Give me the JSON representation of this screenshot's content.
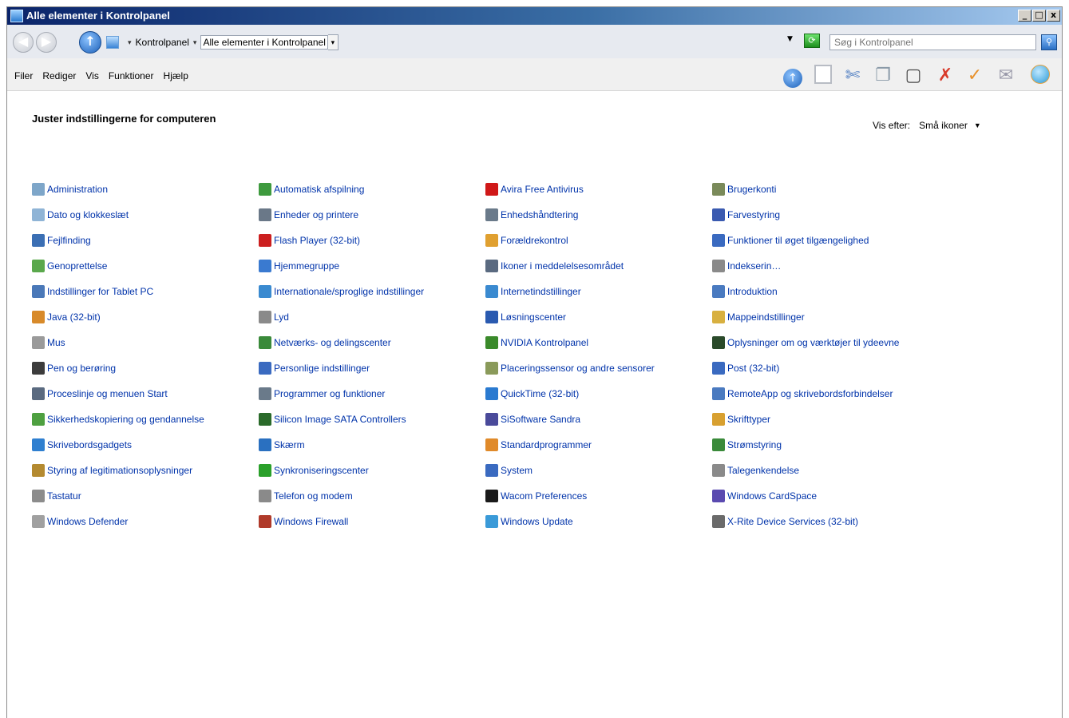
{
  "window": {
    "title": "Alle elementer i Kontrolpanel"
  },
  "caption_buttons": {
    "minimize": "_",
    "maximize": "□",
    "close": "x"
  },
  "address": {
    "crumbs": [
      "Kontrolpanel",
      "Alle elementer i Kontrolpanel"
    ],
    "separator": "▾"
  },
  "search": {
    "placeholder": "Søg i Kontrolpanel"
  },
  "menu": [
    "Filer",
    "Rediger",
    "Vis",
    "Funktioner",
    "Hjælp"
  ],
  "toolbar_icons": [
    "up-icon",
    "panel-icon",
    "cut-icon",
    "copy-icon",
    "paste-icon",
    "delete-icon",
    "check-icon",
    "mail-icon",
    "globe-icon"
  ],
  "content": {
    "title": "Juster indstillingerne for computeren",
    "view_by_label": "Vis efter:",
    "view_by_value": "Små ikoner"
  },
  "columns": [
    [
      {
        "label": "Administration",
        "icon": "gear-icon",
        "color": "#7ea6c9"
      },
      {
        "label": "Dato og klokkeslæt",
        "icon": "clock-icon",
        "color": "#8fb4d6"
      },
      {
        "label": "Fejlfinding",
        "icon": "monitor-icon",
        "color": "#3b6fb4"
      },
      {
        "label": "Genoprettelse",
        "icon": "restore-icon",
        "color": "#5aa84c"
      },
      {
        "label": "Indstillinger for Tablet PC",
        "icon": "tablet-icon",
        "color": "#4a78b8"
      },
      {
        "label": "Java (32-bit)",
        "icon": "java-icon",
        "color": "#d88a2a"
      },
      {
        "label": "Mus",
        "icon": "mouse-icon",
        "color": "#9a9a9a"
      },
      {
        "label": "Pen og berøring",
        "icon": "pen-icon",
        "color": "#3c3c3c"
      },
      {
        "label": "Proceslinje og menuen Start",
        "icon": "taskbar-icon",
        "color": "#5a6a80"
      },
      {
        "label": "Sikkerhedskopiering og gendannelse",
        "icon": "backup-icon",
        "color": "#4ea040"
      },
      {
        "label": "Skrivebordsgadgets",
        "icon": "gadgets-icon",
        "color": "#2f7fd0"
      },
      {
        "label": "Styring af legitimationsoplysninger",
        "icon": "credentials-icon",
        "color": "#b48a30"
      },
      {
        "label": "Tastatur",
        "icon": "keyboard-icon",
        "color": "#8c8c8c"
      },
      {
        "label": "Windows Defender",
        "icon": "defender-icon",
        "color": "#a0a0a0"
      }
    ],
    [
      {
        "label": "Automatisk afspilning",
        "icon": "autoplay-icon",
        "color": "#3e9a3e"
      },
      {
        "label": "Enheder og printere",
        "icon": "printer-icon",
        "color": "#6a7888"
      },
      {
        "label": "Flash Player (32-bit)",
        "icon": "flash-icon",
        "color": "#cc1f1f"
      },
      {
        "label": "Hjemmegruppe",
        "icon": "homegroup-icon",
        "color": "#3a7ad0"
      },
      {
        "label": "Internationale/sproglige indstillinger",
        "icon": "globe-clock-icon",
        "color": "#3a8ad0"
      },
      {
        "label": "Lyd",
        "icon": "speaker-icon",
        "color": "#8a8a8a"
      },
      {
        "label": "Netværks- og delingscenter",
        "icon": "network-icon",
        "color": "#3a8a3a"
      },
      {
        "label": "Personlige indstillinger",
        "icon": "personalize-icon",
        "color": "#3a6ac0"
      },
      {
        "label": "Programmer og funktioner",
        "icon": "programs-icon",
        "color": "#6a7a8a"
      },
      {
        "label": "Silicon Image SATA Controllers",
        "icon": "sata-icon",
        "color": "#2a6a2a"
      },
      {
        "label": "Skærm",
        "icon": "display-icon",
        "color": "#2a70c0"
      },
      {
        "label": "Synkroniseringscenter",
        "icon": "sync-icon",
        "color": "#2aa02a"
      },
      {
        "label": "Telefon og modem",
        "icon": "phone-icon",
        "color": "#8a8a8a"
      },
      {
        "label": "Windows Firewall",
        "icon": "firewall-icon",
        "color": "#b03a2a"
      }
    ],
    [
      {
        "label": "Avira Free Antivirus",
        "icon": "avira-icon",
        "color": "#d01818"
      },
      {
        "label": "Enhedshåndtering",
        "icon": "device-manager-icon",
        "color": "#6a7a8a"
      },
      {
        "label": "Forældrekontrol",
        "icon": "parental-icon",
        "color": "#e0a030"
      },
      {
        "label": "Ikoner i meddelelsesområdet",
        "icon": "tray-icon",
        "color": "#5a6a80"
      },
      {
        "label": "Internetindstillinger",
        "icon": "internet-icon",
        "color": "#3a8ad0"
      },
      {
        "label": "Løsningscenter",
        "icon": "flag-icon",
        "color": "#2a5ab0"
      },
      {
        "label": "NVIDIA Kontrolpanel",
        "icon": "nvidia-icon",
        "color": "#3a8a2a"
      },
      {
        "label": "Placeringssensor og andre sensorer",
        "icon": "sensor-icon",
        "color": "#8a9a5a"
      },
      {
        "label": "QuickTime (32-bit)",
        "icon": "quicktime-icon",
        "color": "#2a7ad0"
      },
      {
        "label": "SiSoftware Sandra",
        "icon": "sandra-icon",
        "color": "#4a4a9a"
      },
      {
        "label": "Standardprogrammer",
        "icon": "default-programs-icon",
        "color": "#e08a2a"
      },
      {
        "label": "System",
        "icon": "system-icon",
        "color": "#3a6ac0"
      },
      {
        "label": "Wacom Preferences",
        "icon": "wacom-icon",
        "color": "#1a1a1a"
      },
      {
        "label": "Windows Update",
        "icon": "update-icon",
        "color": "#3a9ad8"
      }
    ],
    [
      {
        "label": "Brugerkonti",
        "icon": "users-icon",
        "color": "#7a8a5a"
      },
      {
        "label": "Farvestyring",
        "icon": "color-management-icon",
        "color": "#3a5ab0"
      },
      {
        "label": "Funktioner til øget tilgængelighed",
        "icon": "accessibility-icon",
        "color": "#3a6ac0"
      },
      {
        "label": "Indekserin…",
        "icon": "indexing-icon",
        "color": "#8a8a8a"
      },
      {
        "label": "Introduktion",
        "icon": "getting-started-icon",
        "color": "#4a7ac0"
      },
      {
        "label": "Mappeindstillinger",
        "icon": "folder-options-icon",
        "color": "#d8b040"
      },
      {
        "label": "Oplysninger om og værktøjer til ydeevne",
        "icon": "performance-icon",
        "color": "#2a4a2a"
      },
      {
        "label": "Post (32-bit)",
        "icon": "mail-icon",
        "color": "#3a6ac0"
      },
      {
        "label": "RemoteApp og skrivebordsforbindelser",
        "icon": "remoteapp-icon",
        "color": "#4a7ac0"
      },
      {
        "label": "Skrifttyper",
        "icon": "fonts-icon",
        "color": "#d8a030"
      },
      {
        "label": "Strømstyring",
        "icon": "power-icon",
        "color": "#3a8a3a"
      },
      {
        "label": "Talegenkendelse",
        "icon": "microphone-icon",
        "color": "#8a8a8a"
      },
      {
        "label": "Windows CardSpace",
        "icon": "cardspace-icon",
        "color": "#5a4ab0"
      },
      {
        "label": "X-Rite Device Services (32-bit)",
        "icon": "xrite-icon",
        "color": "#6a6a6a"
      }
    ]
  ]
}
